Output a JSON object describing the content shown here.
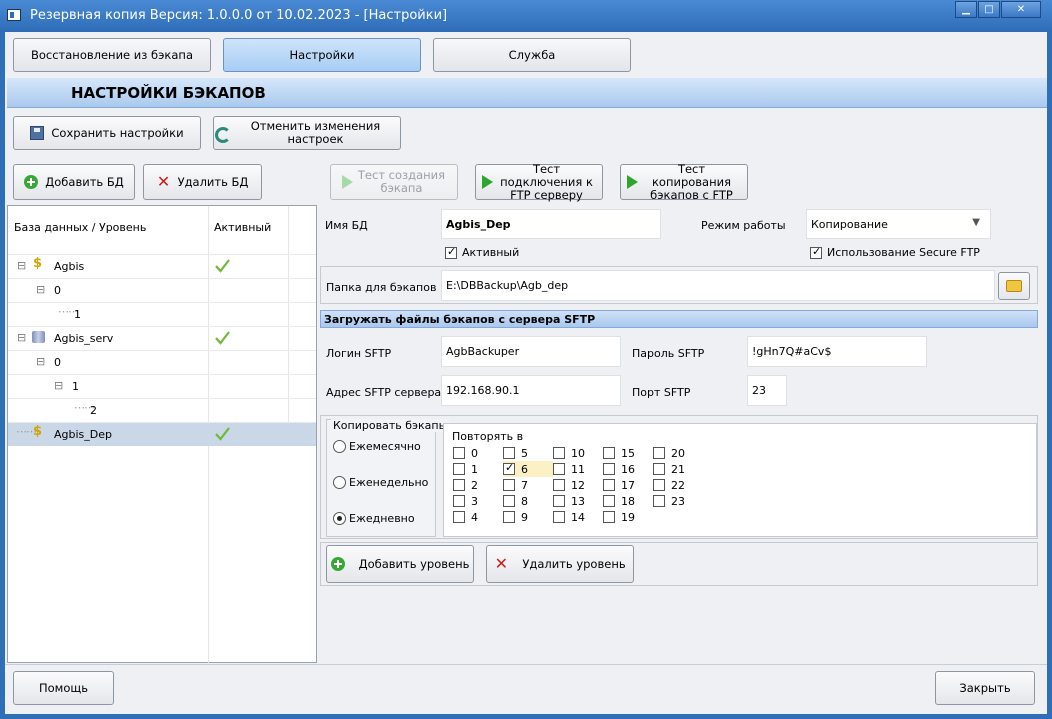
{
  "window": {
    "title": "Резервная копия  Версия: 1.0.0.0 от 10.02.2023 - [Настройки]",
    "controls": [
      "▁",
      "□",
      "✕"
    ]
  },
  "tabs": [
    {
      "label": "Восстановление из бэкапа",
      "active": false
    },
    {
      "label": "Настройки",
      "active": true
    },
    {
      "label": "Служба",
      "active": false
    }
  ],
  "section_title": "НАСТРОЙКИ БЭКАПОВ",
  "toolbar": {
    "save_label": "Сохранить настройки",
    "revert_label": "Отменить изменения настроек"
  },
  "db_actions": {
    "add_label": "Добавить БД",
    "delete_label": "Удалить БД"
  },
  "tests": {
    "create_backup": "Тест создания бэкапа",
    "ftp_connect": "Тест подключения к FTP серверу",
    "copy_ftp": "Тест копирования бэкапов с FTP"
  },
  "tree": {
    "col_name": "База данных / Уровень",
    "col_active": "Активный",
    "rows": [
      {
        "label": "Agbis",
        "type": "db",
        "active": true
      },
      {
        "label": "0",
        "type": "level"
      },
      {
        "label": "1",
        "type": "level"
      },
      {
        "label": "Agbis_serv",
        "type": "db",
        "active": true
      },
      {
        "label": "0",
        "type": "level"
      },
      {
        "label": "1",
        "type": "level"
      },
      {
        "label": "2",
        "type": "level"
      },
      {
        "label": "Agbis_Dep",
        "type": "db",
        "active": true,
        "selected": true
      }
    ]
  },
  "form": {
    "db_name_label": "Имя БД",
    "db_name_value": "Agbis_Dep",
    "mode_label": "Режим работы",
    "mode_value": "Копирование",
    "active_label": "Активный",
    "active_checked": true,
    "secure_ftp_label": "Использование Secure FTP",
    "secure_ftp_checked": true,
    "folder_label": "Папка для бэкапов",
    "folder_value": "E:\\DBBackup\\Agb_dep",
    "sftp_section_title": "Загружать файлы бэкапов с сервера SFTP",
    "sftp_login_label": "Логин SFTP",
    "sftp_login_value": "AgbBackuper",
    "sftp_password_label": "Пароль SFTP",
    "sftp_password_value": "!gHn7Q#aCv$",
    "sftp_address_label": "Адрес SFTP сервера",
    "sftp_address_value": "192.168.90.1",
    "sftp_port_label": "Порт SFTP",
    "sftp_port_value": "23"
  },
  "schedule": {
    "copy_group_label": "Копировать бэкапы",
    "options": [
      {
        "label": "Ежемесячно",
        "checked": false
      },
      {
        "label": "Еженедельно",
        "checked": false
      },
      {
        "label": "Ежедневно",
        "checked": true
      }
    ],
    "repeat_label": "Повторять в",
    "hours_checked": [
      6
    ],
    "hours_highlighted": [
      6
    ]
  },
  "level_actions": {
    "add_label": "Добавить уровень",
    "delete_label": "Удалить уровень"
  },
  "footer": {
    "help_label": "Помощь",
    "close_label": "Закрыть"
  },
  "colors": {
    "window_frame": "#2f6fb8",
    "active_tab": "#a7cdf3",
    "accent_green": "#35a835",
    "delete_red": "#c81e1e",
    "selected_row": "#c9d7e6"
  }
}
